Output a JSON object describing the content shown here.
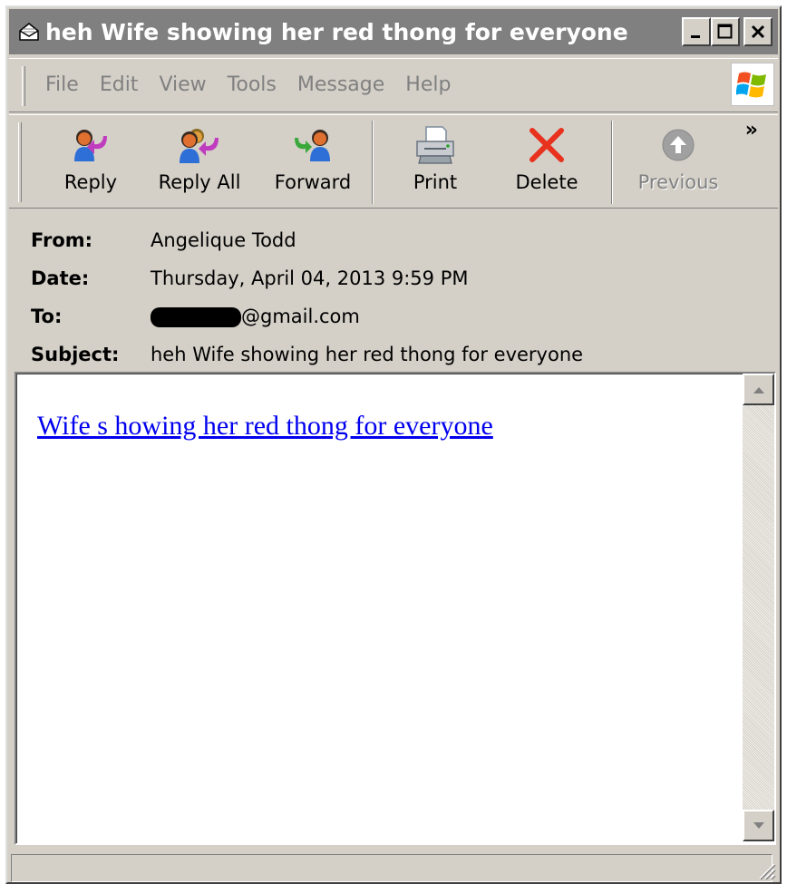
{
  "window": {
    "title": "heh  Wife showing her red thong for everyone",
    "icon": "mail-envelope-icon",
    "controls": {
      "minimize": "_",
      "maximize": "□",
      "close": "X"
    }
  },
  "menubar": {
    "items": [
      "File",
      "Edit",
      "View",
      "Tools",
      "Message",
      "Help"
    ],
    "logo": "windows-flag-icon"
  },
  "toolbar": {
    "buttons": [
      {
        "label": "Reply",
        "icon": "reply-icon",
        "enabled": true
      },
      {
        "label": "Reply All",
        "icon": "reply-all-icon",
        "enabled": true
      },
      {
        "label": "Forward",
        "icon": "forward-icon",
        "enabled": true
      },
      {
        "label": "Print",
        "icon": "printer-icon",
        "enabled": true
      },
      {
        "label": "Delete",
        "icon": "delete-x-icon",
        "enabled": true
      },
      {
        "label": "Previous",
        "icon": "previous-arrow-icon",
        "enabled": false
      }
    ],
    "overflow": "»"
  },
  "headers": {
    "from_label": "From:",
    "from_value": "Angelique Todd",
    "date_label": "Date:",
    "date_value": "Thursday, April 04, 2013 9:59 PM",
    "to_label": "To:",
    "to_value_suffix": "@gmail.com",
    "subject_label": "Subject:",
    "subject_value": "heh  Wife showing her red thong for everyone"
  },
  "body": {
    "link_text": "Wife s howing her red thong for everyone"
  },
  "colors": {
    "window_bg": "#d4d0c8",
    "titlebar_bg": "#808080",
    "link": "#0000ee",
    "delete_red": "#e8321e"
  }
}
